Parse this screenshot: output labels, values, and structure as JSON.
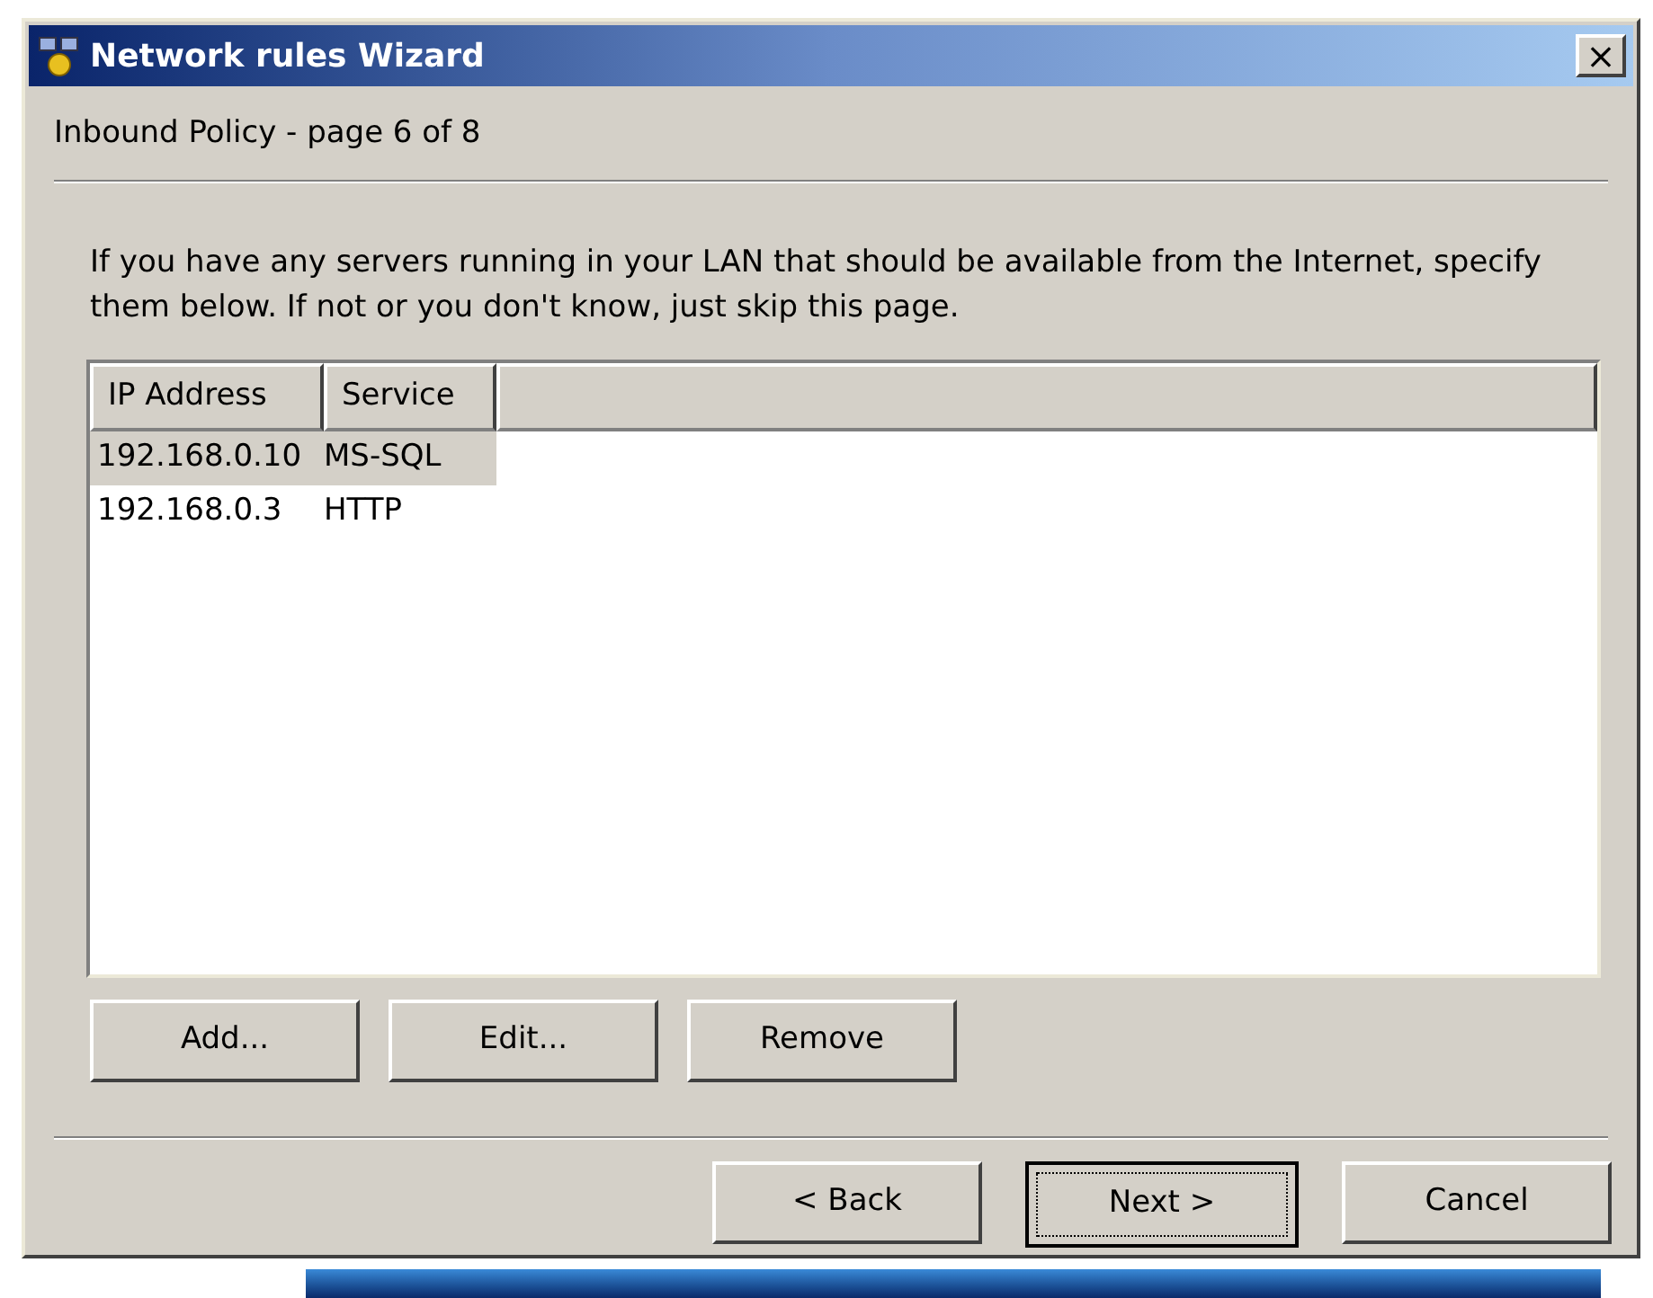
{
  "window": {
    "title": "Network rules Wizard",
    "close": "×"
  },
  "page_title": "Inbound Policy - page 6 of 8",
  "description": "If you have any servers running in your LAN that should be available from the Internet, specify them below. If not or you don't know, just skip this page.",
  "table": {
    "columns": [
      "IP Address",
      "Service"
    ],
    "rows": [
      {
        "cells": [
          "192.168.0.10",
          "MS-SQL"
        ],
        "selected": true
      },
      {
        "cells": [
          "192.168.0.3",
          "HTTP"
        ],
        "selected": false
      }
    ]
  },
  "list_buttons": [
    "Add...",
    "Edit...",
    "Remove"
  ],
  "nav_buttons": [
    {
      "label": "< Back",
      "focused": false
    },
    {
      "label": "Next >",
      "focused": true
    },
    {
      "label": "Cancel",
      "focused": false
    }
  ]
}
